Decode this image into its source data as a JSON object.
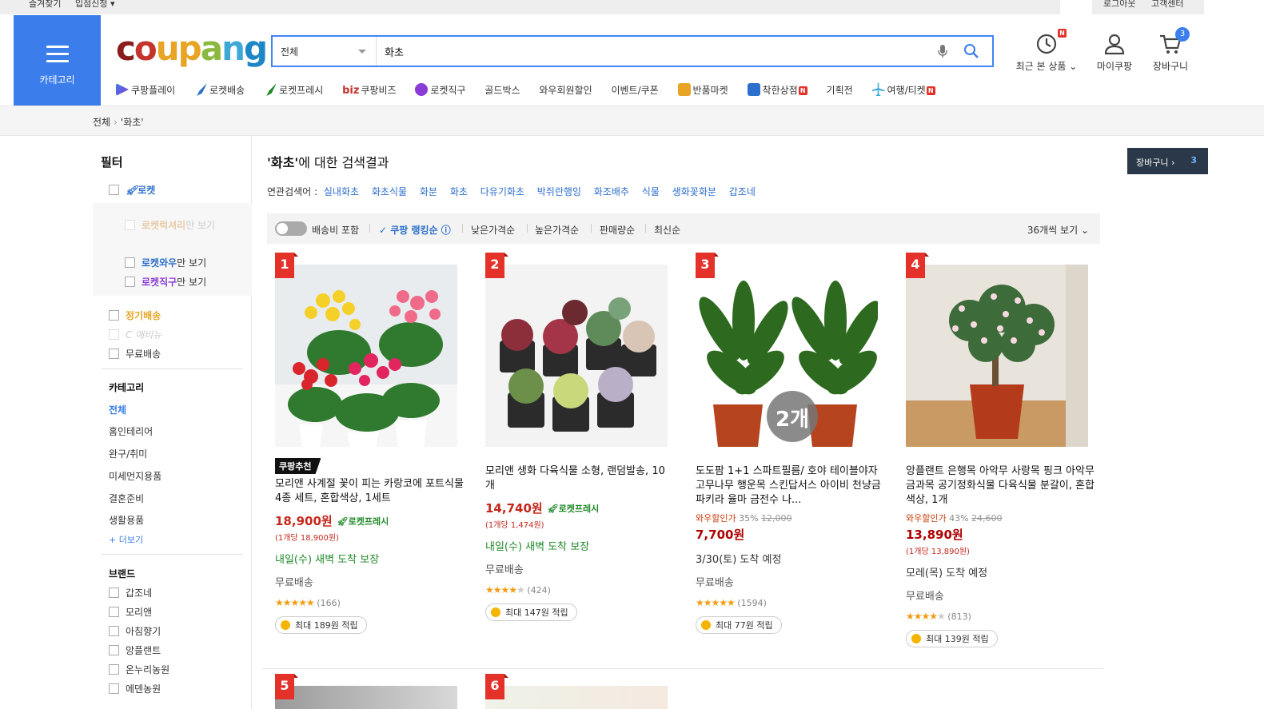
{
  "topbar": {
    "links": [
      "즐겨찾기",
      "입점신청 ▾"
    ],
    "right": [
      "로그아웃",
      "고객센터"
    ]
  },
  "header": {
    "category_label": "카테고리",
    "logo": [
      "cou",
      "p",
      "a",
      "n",
      "g"
    ],
    "search": {
      "category": "전체",
      "query": "화초"
    },
    "icons": {
      "recent": "최근 본 상품",
      "mypage": "마이쿠팡",
      "cart": "장바구니",
      "cart_count": "3",
      "recent_badge": "N"
    }
  },
  "gnb": [
    {
      "label": "쿠팡플레이",
      "icon": "play-icon",
      "color": "#3b7dea"
    },
    {
      "label": "로켓배송",
      "icon": "rocket-icon",
      "color": "#2d6fcc"
    },
    {
      "label": "로켓프레시",
      "icon": "rocket-fresh-icon",
      "color": "#1f8a28"
    },
    {
      "label": "쿠팡비즈",
      "prefix": "biz"
    },
    {
      "label": "로켓직구",
      "icon": "global-icon",
      "color": "#8b3bd6"
    },
    {
      "label": "골드박스"
    },
    {
      "label": "와우회원할인"
    },
    {
      "label": "이벤트/쿠폰"
    },
    {
      "label": "반품마켓",
      "icon": "box-icon",
      "color": "#e8a424"
    },
    {
      "label": "착한상점",
      "icon": "store-icon",
      "color": "#2d6fcc",
      "badge": "N"
    },
    {
      "label": "기획전"
    },
    {
      "label": "여행/티켓",
      "icon": "plane-icon",
      "color": "#3ea8d6",
      "badge": "N"
    }
  ],
  "breadcrumb": {
    "root": "전체",
    "current": "'화초'"
  },
  "sidebar": {
    "title": "필터",
    "rocket": "로켓",
    "rocket_sub": {
      "luxury": "로켓럭셔리",
      "luxury_suffix": "만 보기",
      "wow": "로켓와우",
      "wow_suffix": "만 보기",
      "direct": "로켓직구",
      "direct_suffix": "만 보기"
    },
    "subscription": "정기배송",
    "review": "C 애비뉴",
    "free_shipping": "무료배송",
    "category_title": "카테고리",
    "categories": [
      "전체",
      "홈인테리어",
      "완구/취미",
      "미세먼지용품",
      "결혼준비",
      "생활용품"
    ],
    "more": "+ 더보기",
    "brand_title": "브랜드",
    "brands": [
      "갑조네",
      "모리앤",
      "아침향기",
      "앙플랜트",
      "온누리농원",
      "에덴농원"
    ]
  },
  "main": {
    "title_query": "'화초'",
    "title_rest": "에 대한 검색결과",
    "related_label": "연관검색어 :",
    "related": [
      "실내화초",
      "화초식물",
      "화분",
      "화초",
      "다유기화초",
      "박쥐란행잉",
      "화조배추",
      "식물",
      "생화꽃화분",
      "갑조네"
    ],
    "cart_float": {
      "label": "장바구니 ›",
      "count": "3"
    },
    "sort": {
      "shipping_toggle": "배송비 포함",
      "options": [
        "✓ 쿠팡 랭킹순 ⓘ",
        "낮은가격순",
        "높은가격순",
        "판매량순",
        "최신순"
      ],
      "view": "36개씩 보기"
    }
  },
  "products": [
    {
      "rank": "1",
      "recommended": "쿠팡추천",
      "name": "모리앤 사계절 꽃이 피는 카랑코에 포트식물 4종 세트, 혼합색상, 1세트",
      "price": "18,900원",
      "fresh": "로켓프레시",
      "unit": "(1개당 18,900원)",
      "delivery": "내일(수) 새벽 도착 보장",
      "shipping": "무료배송",
      "rating": 4.5,
      "reviews": "(166)",
      "reward": "최대 189원 적립"
    },
    {
      "rank": "2",
      "name": "모리앤 생화 다육식물 소형, 랜덤발송, 10개",
      "price": "14,740원",
      "fresh": "로켓프레시",
      "unit": "(1개당 1,474원)",
      "delivery": "내일(수) 새벽 도착 보장",
      "shipping": "무료배송",
      "rating": 4,
      "reviews": "(424)",
      "reward": "최대 147원 적립"
    },
    {
      "rank": "3",
      "name": "도도팜 1+1 스파트필름/ 호야 테이블야자 고무나무 행운목 스킨답서스 아이비 천냥금 파키라 율마 금전수 나...",
      "disc_label": "와우할인가",
      "disc_rate": "35%",
      "orig": "12,000",
      "price": "7,700원",
      "delivery": "3/30(토) 도착 예정",
      "shipping": "무료배송",
      "rating": 4.5,
      "reviews": "(1594)",
      "reward": "최대 77원 적립",
      "overlay": "2개"
    },
    {
      "rank": "4",
      "name": "앙플랜트 은행목 아악무 사랑목 핑크 아악무 금과목 공기정화식물 다육식물 분갈이, 혼합색상, 1개",
      "disc_label": "와우할인가",
      "disc_rate": "43%",
      "orig": "24,600",
      "price": "13,890원",
      "unit": "(1개당 13,890원)",
      "delivery": "모레(목) 도착 예정",
      "shipping": "무료배송",
      "rating": 4,
      "reviews": "(813)",
      "reward": "최대 139원 적립"
    },
    {
      "rank": "5"
    },
    {
      "rank": "6"
    }
  ],
  "colors": {
    "accent": "#3b7dea",
    "rank_red": "#e4322a",
    "price_red": "#c4281c",
    "fresh_green": "#1f8a28"
  }
}
